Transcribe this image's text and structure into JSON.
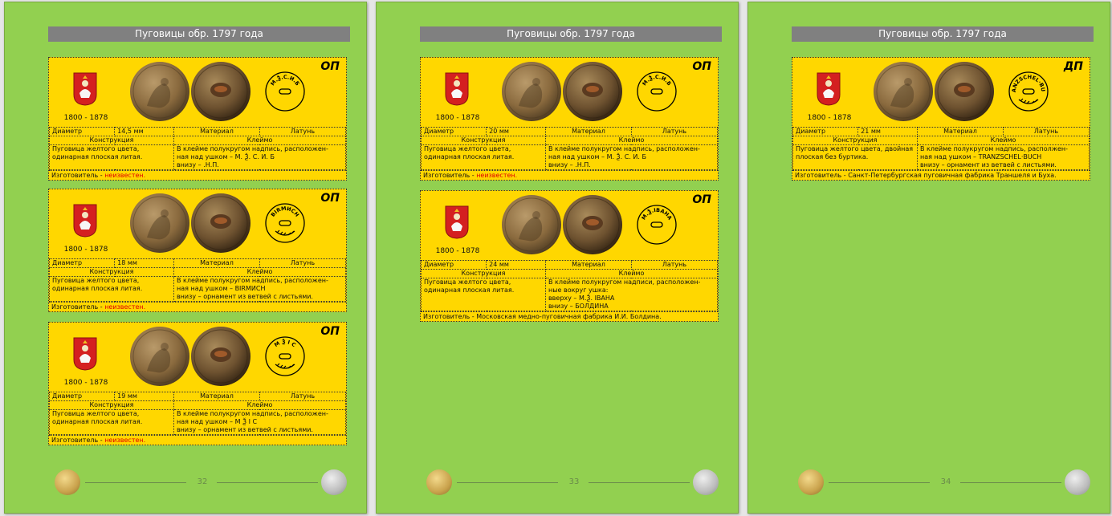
{
  "header_title": "Пуговицы обр. 1797 года",
  "labels": {
    "diameter": "Диаметр",
    "material": "Материал",
    "construction": "Конструкция",
    "stamp": "Клеймо",
    "maker_prefix": "Изготовитель - "
  },
  "pages": [
    {
      "page_number": "32",
      "cards": [
        {
          "code": "ОП",
          "years": "1800 - 1878",
          "diameter": "14,5 мм",
          "material": "Латунь",
          "construction": "Пуговица желтого цвета, одинарная плоская литая.",
          "stamp_line1": "В клейме полукругом надпись, расположен-",
          "stamp_line2": "ная над ушком – М. Ѯ. С. И. Б",
          "stamp_line3": "внизу – .Н.П.",
          "maker": "неизвестен.",
          "maker_red": true,
          "stamp_text": "М.Ѯ.С.И.Б"
        },
        {
          "code": "ОП",
          "years": "1800 - 1878",
          "diameter": "18 мм",
          "material": "Латунь",
          "construction": "Пуговица желтого цвета, одинарная плоская литая.",
          "stamp_line1": "В клейме полукругом надпись, расположен-",
          "stamp_line2": "ная над ушком – BIRMИСН",
          "stamp_line3": "внизу – орнамент из ветвей с листьями.",
          "maker": "неизвестен.",
          "maker_red": true,
          "stamp_text": "BIRMИСН"
        },
        {
          "code": "ОП",
          "years": "1800 - 1878",
          "diameter": "19 мм",
          "material": "Латунь",
          "construction": "Пуговица желтого цвета, одинарная плоская литая.",
          "stamp_line1": "В клейме полукругом надпись, расположен-",
          "stamp_line2": "ная над ушком – М Ѯ I С",
          "stamp_line3": "внизу – орнамент из ветвей с листьями.",
          "maker": "неизвестен.",
          "maker_red": true,
          "stamp_text": "М Ѯ I С"
        }
      ]
    },
    {
      "page_number": "33",
      "cards": [
        {
          "code": "ОП",
          "years": "1800 - 1878",
          "diameter": "20 мм",
          "material": "Латунь",
          "construction": "Пуговица желтого цвета, одинарная плоская литая.",
          "stamp_line1": "В клейме полукругом надпись, расположен-",
          "stamp_line2": "ная над ушком – М. Ѯ. С. И. Б",
          "stamp_line3": "внизу – .Н.П.",
          "maker": "неизвестен.",
          "maker_red": true,
          "stamp_text": "М.Ѯ.С.И.Б"
        },
        {
          "code": "ОП",
          "years": "1800 - 1878",
          "diameter": "24 мм",
          "material": "Латунь",
          "construction": "Пуговица желтого цвета, одинарная плоская литая.",
          "stamp_line1": "В клейме полукругом надписи, расположен-",
          "stamp_line2": "ные вокруг ушка:",
          "stamp_line3": "вверху – М.Ѯ. IВАНА",
          "stamp_line4": "внизу – БОЛДИНА",
          "maker": "Московская медно-пуговичная фабрика И.И. Болдина.",
          "maker_red": false,
          "stamp_text": "М.Ѯ.IВАНА"
        }
      ]
    },
    {
      "page_number": "34",
      "cards": [
        {
          "code": "ДП",
          "years": "1800 - 1878",
          "diameter": "21 мм",
          "material": "Латунь",
          "construction": "Пуговица желтого цвета, двойная плоская без буртика.",
          "stamp_line1": "В клейме полукругом надпись, располжен-",
          "stamp_line2": "ная над ушком – TRANZSCHEL·BUCH",
          "stamp_line3": "внизу – орнамент из ветвей с листьями.",
          "maker": "Санкт-Петербургская пуговичная фабрика Траншеля и Буха.",
          "maker_red": false,
          "stamp_text": "TRANZSCHEL·BUCH"
        }
      ]
    }
  ],
  "colors": {
    "page_bg": "#92d050",
    "card_bg": "#ffd700",
    "header_bg": "#808080",
    "maker_red": "#e00000"
  }
}
